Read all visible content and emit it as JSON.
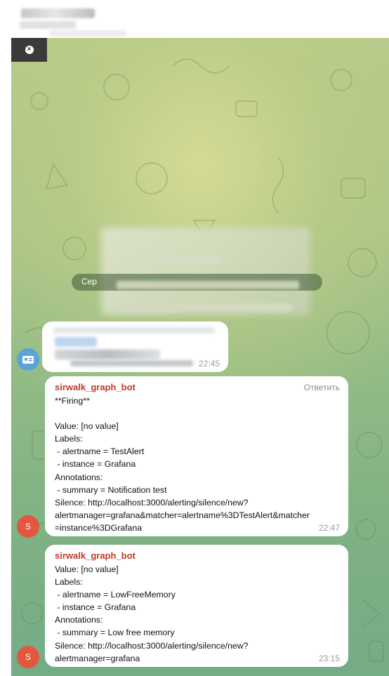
{
  "window": {
    "close_icon": "×"
  },
  "service_message": {
    "visible_prefix": "Cep"
  },
  "messages": [
    {
      "time": "22:45"
    },
    {
      "sender": "sirwalk_graph_bot",
      "reply_label": "Ответить",
      "avatar_letter": "S",
      "text": "**Firing**\n\nValue: [no value]\nLabels:\n - alertname = TestAlert\n - instance = Grafana\nAnnotations:\n - summary = Notification test\nSilence: http://localhost:3000/alerting/silence/new?\nalertmanager=grafana&matcher=alertname%3DTestAlert&matcher\n=instance%3DGrafana",
      "time": "22:47"
    },
    {
      "sender": "sirwalk_graph_bot",
      "avatar_letter": "S",
      "text": "Value: [no value]\nLabels:\n - alertname = LowFreeMemory\n - instance = Grafana\nAnnotations:\n - summary = Low free memory\nSilence: http://localhost:3000/alerting/silence/new?\nalertmanager=grafana",
      "time": "23:15"
    }
  ],
  "colors": {
    "sender": "#c0392b",
    "avatar_red": "#e2573d",
    "avatar_blue": "#5ba3d8"
  }
}
